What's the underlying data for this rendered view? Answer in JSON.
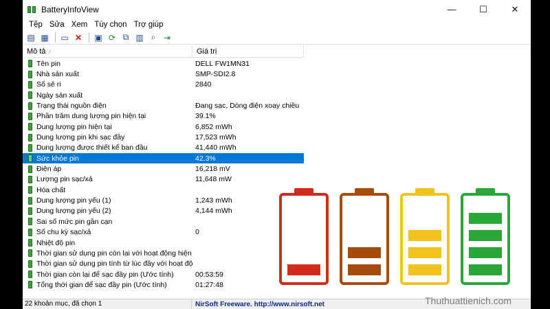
{
  "window": {
    "title": "BatteryInfoView"
  },
  "controls": {
    "minimize": "—",
    "maximize": "☐",
    "close": "✕"
  },
  "menu": [
    "Tệp",
    "Sửa",
    "Xem",
    "Tùy chọn",
    "Trợ giúp"
  ],
  "toolbar": {
    "icons": [
      "view-list-icon",
      "view-grid-icon",
      "properties-icon",
      "delete-icon",
      "save-icon",
      "refresh-icon",
      "copy-icon",
      "html-report-icon",
      "find-icon",
      "exit-icon"
    ]
  },
  "columns": [
    "Mô tả",
    "Giá trị"
  ],
  "rows": [
    {
      "name": "Tên pin",
      "value": "DELL FW1MN31"
    },
    {
      "name": "Nhà sản xuất",
      "value": "SMP-SDI2.8"
    },
    {
      "name": "Số sê ri",
      "value": "2840"
    },
    {
      "name": "Ngày sản xuất",
      "value": ""
    },
    {
      "name": "Trạng thái nguồn điện",
      "value": "Đang sạc, Dòng điện xoay chiều"
    },
    {
      "name": "Phần trăm dung lượng pin hiện tại",
      "value": "39.1%"
    },
    {
      "name": "Dung lượng pin hiện tại",
      "value": "6,852 mWh"
    },
    {
      "name": "Dung lượng pin khi sạc đầy",
      "value": "17,523 mWh"
    },
    {
      "name": "Dung lượng được thiết kế ban đầu",
      "value": "41,440 mWh"
    },
    {
      "name": "Sức khỏe pin",
      "value": "42.3%",
      "selected": true
    },
    {
      "name": "Điện áp",
      "value": "16,218 mV"
    },
    {
      "name": "Lượng pin sạc/xả",
      "value": "11,648 mW"
    },
    {
      "name": "Hóa chất",
      "value": ""
    },
    {
      "name": "Dung lượng pin yếu (1)",
      "value": "1,243 mWh"
    },
    {
      "name": "Dung lượng pin yếu (2)",
      "value": "4,144 mWh"
    },
    {
      "name": "Sai số mức pin gần cạn",
      "value": ""
    },
    {
      "name": "Số chu kỳ sạc/xả",
      "value": "0"
    },
    {
      "name": "Nhiệt độ pin",
      "value": ""
    },
    {
      "name": "Thời gian sử dụng pin còn lại với hoạt động hiện t...",
      "value": ""
    },
    {
      "name": "Thời gian sử dụng pin tính từ lúc đầy với hoạt độn...",
      "value": ""
    },
    {
      "name": "Thời gian còn lại để sạc đầy pin (Ước tính)",
      "value": "00:53:59"
    },
    {
      "name": "Tổng thời gian để sạc đầy pin (Ước tính)",
      "value": "01:27:48"
    }
  ],
  "status": {
    "count": "22 khoản mục, đã chọn 1",
    "credit": "NirSoft Freeware.  http://www.nirsoft.net"
  },
  "batteries": [
    {
      "color": "#d42a1a",
      "level": 1,
      "of": 4
    },
    {
      "color": "#a84a0c",
      "level": 2,
      "of": 4
    },
    {
      "color": "#f3c11b",
      "level": 3,
      "of": 4
    },
    {
      "color": "#2aa73a",
      "level": 4,
      "of": 4
    }
  ],
  "watermark": "Thuthuattienich.com"
}
